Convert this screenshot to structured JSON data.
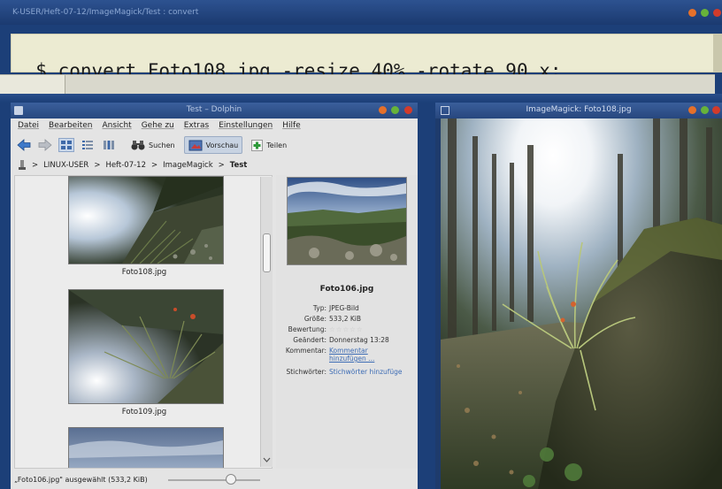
{
  "terminal": {
    "title": "K-USER/Heft-07-12/ImageMagick/Test : convert",
    "command": "$ convert Foto108.jpg -resize 40% -rotate 90 x:"
  },
  "dolphin": {
    "title": "Test – Dolphin",
    "menu": [
      "Datei",
      "Bearbeiten",
      "Ansicht",
      "Gehe zu",
      "Extras",
      "Einstellungen",
      "Hilfe"
    ],
    "toolbar": {
      "search_label": "Suchen",
      "preview_label": "Vorschau",
      "split_label": "Teilen"
    },
    "breadcrumb": [
      "LINUX-USER",
      "Heft-07-12",
      "ImageMagick",
      "Test"
    ],
    "files": [
      {
        "name": "Foto108.jpg"
      },
      {
        "name": "Foto109.jpg"
      }
    ],
    "info": {
      "name": "Foto106.jpg",
      "type_key": "Typ:",
      "type_val": "JPEG-Bild",
      "size_key": "Größe:",
      "size_val": "533,2 KiB",
      "rating_key": "Bewertung:",
      "rating_value": 0,
      "changed_key": "Geändert:",
      "changed_val": "Donnerstag 13:28",
      "comment_key": "Kommentar:",
      "comment_val": "Kommentar hinzufügen ...",
      "tags_key": "Stichwörter:",
      "tags_val": "Stichwörter hinzufüge"
    },
    "status": "„Foto106.jpg\" ausgewählt (533,2 KiB)",
    "zoom_fraction": 0.68
  },
  "magick": {
    "title": "ImageMagick: Foto108.jpg"
  },
  "colors": {
    "desktop": "#1c3f78",
    "terminal_bg": "#ecebd2",
    "link": "#3e6db5",
    "btn_orange": "#e5702a",
    "btn_green": "#67b33a",
    "btn_red": "#d23b2b"
  }
}
